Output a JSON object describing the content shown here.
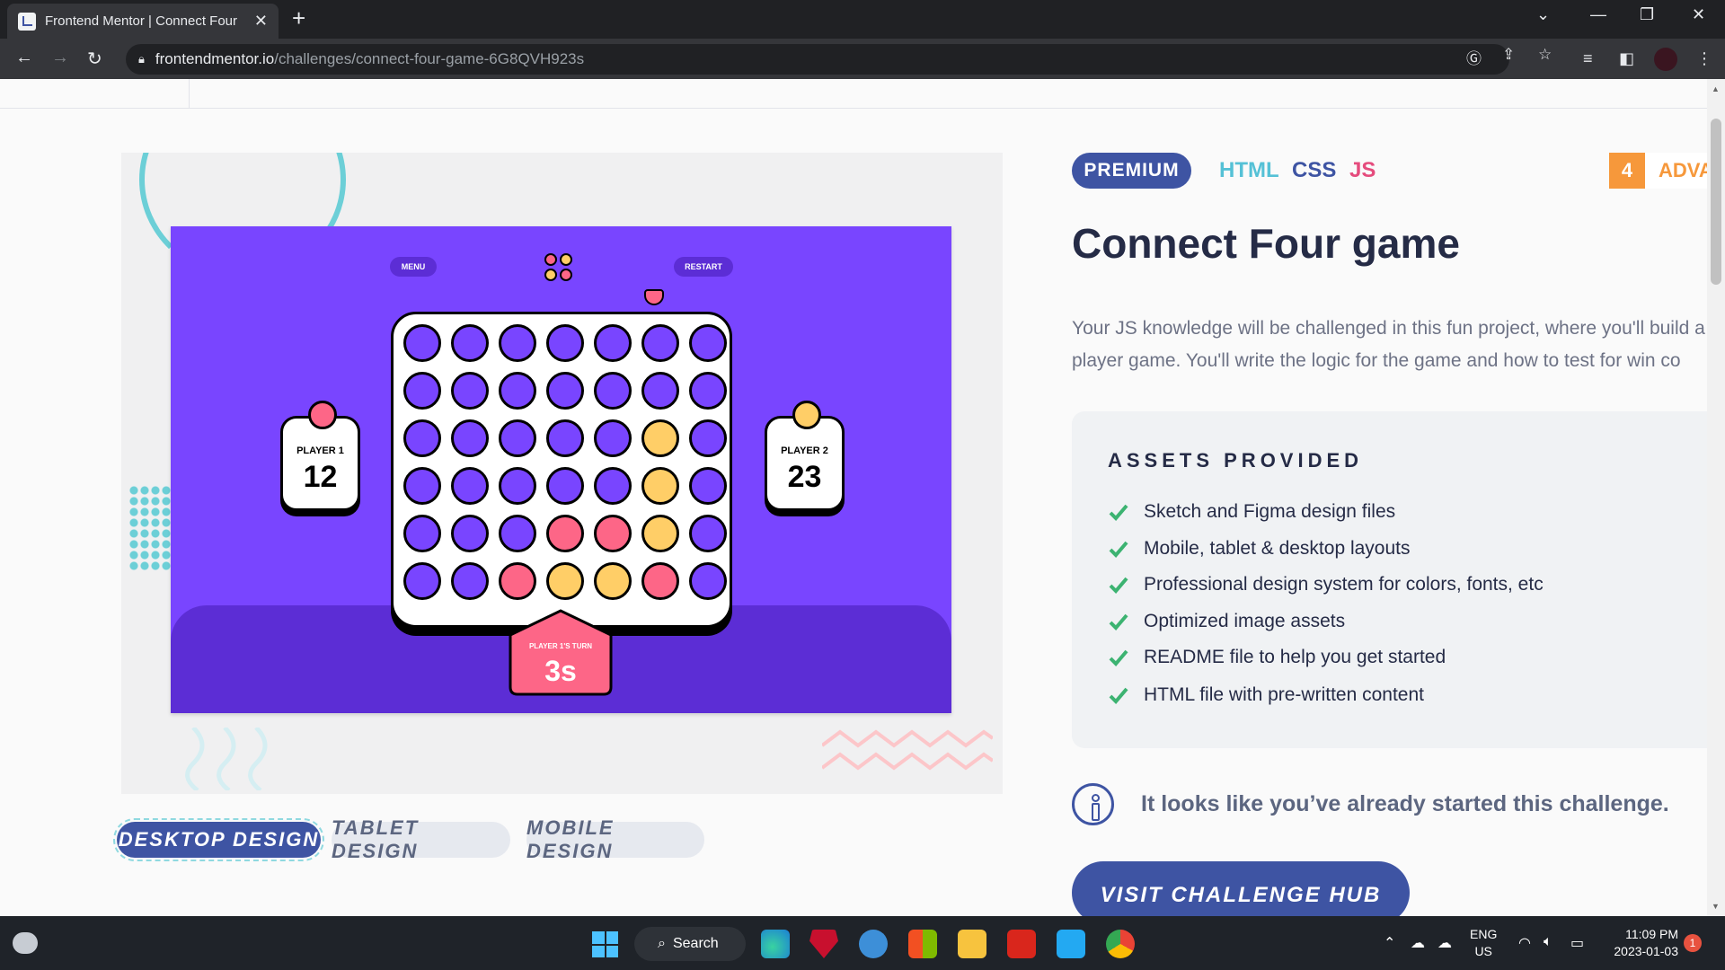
{
  "browser": {
    "tab_title": "Frontend Mentor | Connect Four",
    "new_tab": "+",
    "url_host": "frontendmentor.io",
    "url_path": "/challenges/connect-four-game-6G8QVH923s"
  },
  "challenge": {
    "premium_label": "PREMIUM",
    "languages": [
      "HTML",
      "CSS",
      "JS"
    ],
    "language_colors": [
      "#55c1d6",
      "#3e54a3",
      "#e54c7d"
    ],
    "difficulty_number": "4",
    "difficulty_label": "ADVANCED",
    "title": "Connect Four game",
    "description_line1": "Your JS knowledge will be challenged in this fun project, where you'll build a",
    "description_line2": "player game. You'll write the logic for the game and how to test for win co"
  },
  "assets": {
    "title": "ASSETS PROVIDED",
    "items": [
      "Sketch and Figma design files",
      "Mobile, tablet & desktop layouts",
      "Professional design system for colors, fonts, etc",
      "Optimized image assets",
      "README file to help you get started",
      "HTML file with pre-written content"
    ]
  },
  "status": {
    "info_text": "It looks like you’ve already started this challenge.",
    "visit_button": "VISIT CHALLENGE HUB"
  },
  "design_tabs": [
    "DESKTOP DESIGN",
    "TABLET DESIGN",
    "MOBILE DESIGN"
  ],
  "game_preview": {
    "menu_label": "MENU",
    "restart_label": "RESTART",
    "player1_label": "PLAYER 1",
    "player1_score": "12",
    "player2_label": "PLAYER 2",
    "player2_score": "23",
    "turn_label": "PLAYER 1'S TURN",
    "turn_time": "3s",
    "board": [
      "PPPPPPP",
      "PPPPPPP",
      "PPPPPYP",
      "PPPPPYP",
      "PPPRRYP",
      "PPRYYRP"
    ],
    "colors": {
      "P": "#7945ff",
      "R": "#fd6687",
      "Y": "#ffce67"
    }
  },
  "taskbar": {
    "search_label": "Search",
    "lang_line1": "ENG",
    "lang_line2": "US",
    "time": "11:09 PM",
    "date": "2023-01-03",
    "notification_count": "1"
  }
}
